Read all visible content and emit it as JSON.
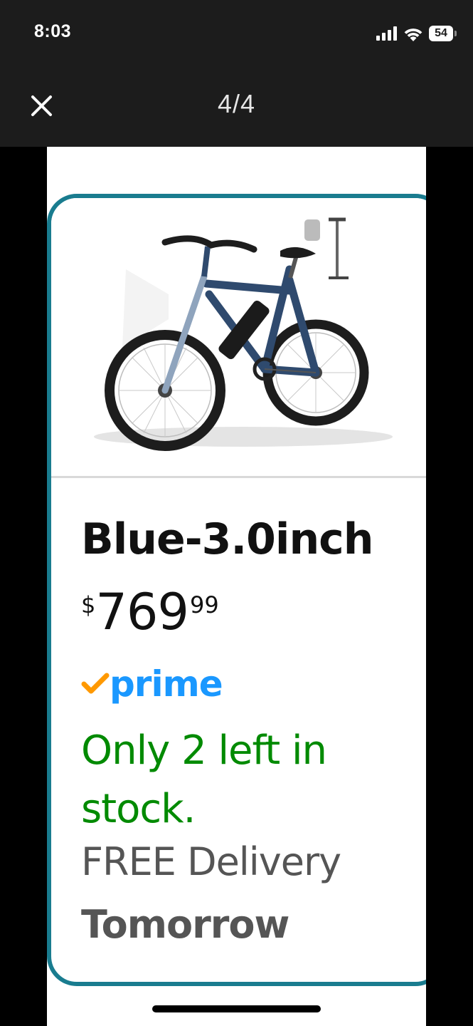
{
  "status_bar": {
    "time": "8:03",
    "battery_level": "54",
    "icons": [
      "cellular-signal-icon",
      "wifi-icon",
      "battery-icon"
    ]
  },
  "viewer": {
    "close_icon": "close-icon",
    "page_counter": "4/4"
  },
  "product": {
    "image": "electric-bicycle-image",
    "variant_name": "Blue-3.0inch",
    "price": {
      "symbol": "$",
      "whole": "769",
      "fraction": "99"
    },
    "prime_label": "prime",
    "stock_status": "Only 2 left in stock.",
    "delivery_label": "FREE Delivery",
    "delivery_day": "Tomorrow"
  },
  "colors": {
    "card_border": "#197c8f",
    "prime_blue": "#1a98ff",
    "prime_check": "#ff9900",
    "stock_green": "#008a00",
    "delivery_gray": "#555555",
    "bar_background": "#1c1c1c"
  }
}
